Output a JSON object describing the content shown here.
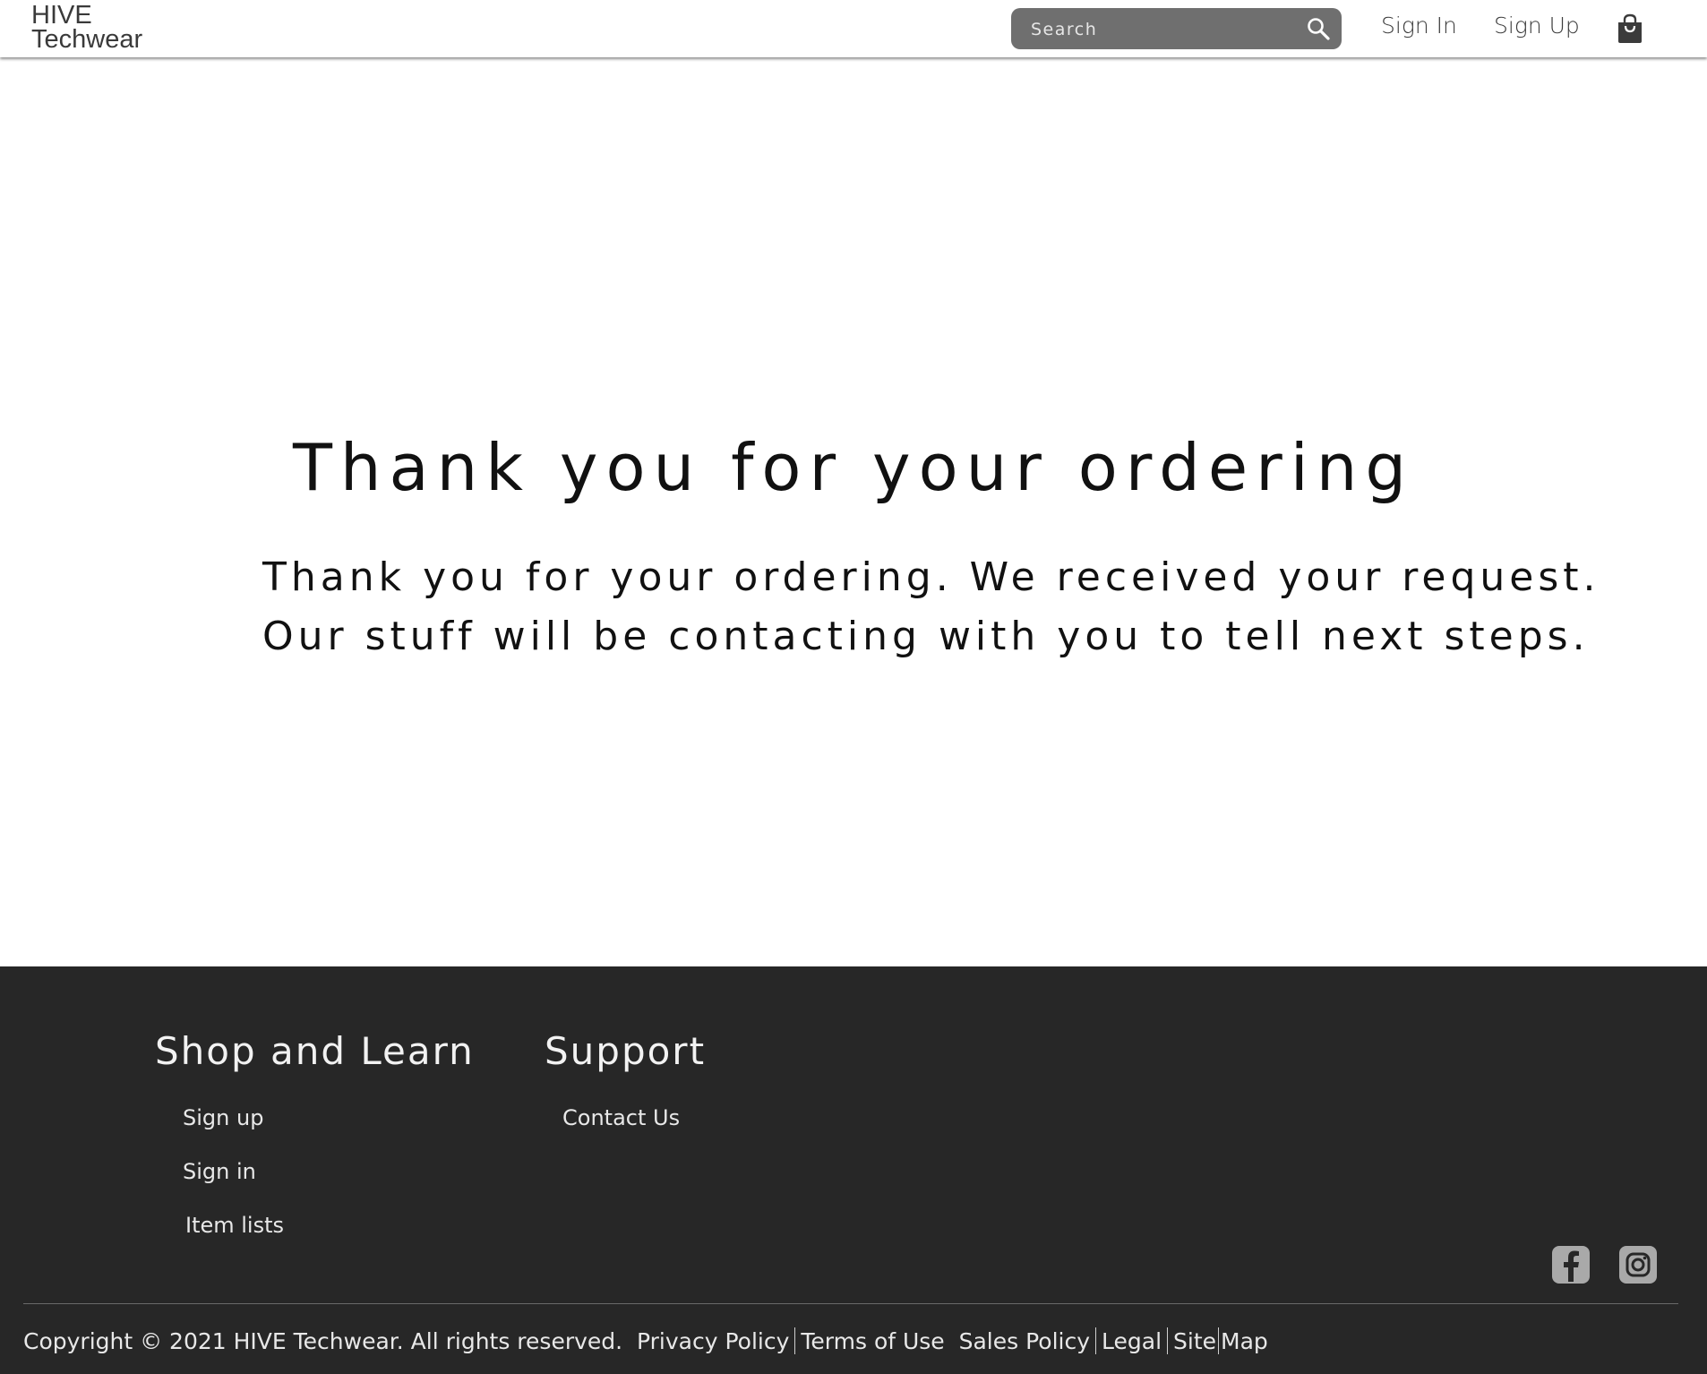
{
  "header": {
    "logo_line1": "HIVE",
    "logo_line2": "Techwear",
    "search_placeholder": "Search",
    "sign_in": "Sign In",
    "sign_up": "Sign Up",
    "icons": [
      "search-icon",
      "shopping-bag-icon"
    ]
  },
  "main": {
    "title": "Thank you for your ordering",
    "message_line1": "Thank you for your ordering. We received your request.",
    "message_line2": "Our stuff will be contacting with you to tell next steps."
  },
  "footer": {
    "shop_heading": "Shop and Learn",
    "shop_links": [
      "Sign up",
      "Sign in",
      "Item lists"
    ],
    "support_heading": "Support",
    "support_links": [
      "Contact Us"
    ],
    "copyright": "Copyright © 2021 HIVE Techwear. All rights reserved.",
    "legal_links": [
      "Privacy Policy",
      "Terms of Use",
      "Sales Policy",
      "Legal",
      "Site",
      "Map"
    ],
    "social_icons": [
      "facebook-icon",
      "instagram-icon"
    ]
  },
  "colors": {
    "footer_bg": "#272727",
    "search_bg": "#6f6f6f",
    "social_icon_bg": "#a9a9a9"
  }
}
